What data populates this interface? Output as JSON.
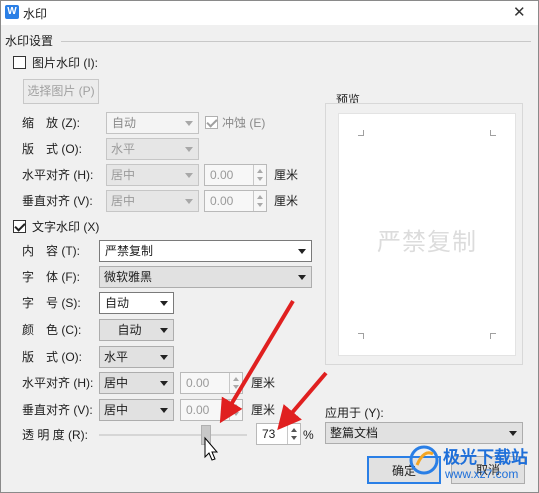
{
  "window": {
    "title": "水印",
    "close_glyph": "✕"
  },
  "section_label": "水印设置",
  "picture_watermark": {
    "checkbox_label": "图片水印 (I):",
    "checked": false,
    "select_button": "选择图片 (P)",
    "scale_label": "缩　放 (Z):",
    "scale_value": "自动",
    "washout_label": "冲蚀 (E)",
    "washout_checked": true,
    "layout_label": "版　式 (O):",
    "layout_value": "水平",
    "h_align_label": "水平对齐 (H):",
    "h_align_value": "居中",
    "h_offset": "0.00",
    "v_align_label": "垂直对齐 (V):",
    "v_align_value": "居中",
    "v_offset": "0.00",
    "unit": "厘米"
  },
  "text_watermark": {
    "checkbox_label": "文字水印 (X)",
    "checked": true,
    "content_label": "内　容 (T):",
    "content_value": "严禁复制",
    "font_label": "字　体 (F):",
    "font_value": "微软雅黑",
    "size_label": "字　号 (S):",
    "size_value": "自动",
    "color_label": "颜　色 (C):",
    "color_value": "自动",
    "layout_label": "版　式 (O):",
    "layout_value": "水平",
    "h_align_label": "水平对齐 (H):",
    "h_align_value": "居中",
    "h_offset": "0.00",
    "v_align_label": "垂直对齐 (V):",
    "v_align_value": "居中",
    "v_offset": "0.00",
    "unit": "厘米",
    "transparency_label": "透 明 度 (R):",
    "transparency_value": "73",
    "transparency_fraction": 0.73,
    "percent_sign": "%"
  },
  "preview": {
    "label": "预览",
    "watermark_text": "严禁复制"
  },
  "apply": {
    "label": "应用于 (Y):",
    "value": "整篇文档"
  },
  "buttons": {
    "ok": "确定",
    "cancel": "取消"
  },
  "brand": {
    "name": "极光下载站",
    "url": "www.xz7.com"
  },
  "colors": {
    "accent_arrow": "#e02020",
    "link_blue": "#2a7fe6"
  }
}
